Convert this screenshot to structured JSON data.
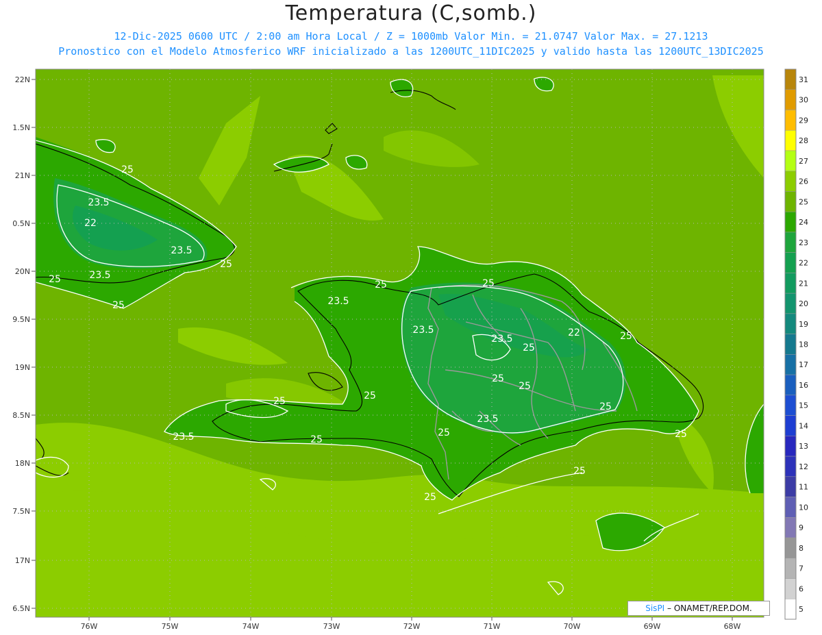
{
  "header": {
    "title": "Temperatura (C,somb.)",
    "subtitle_line1": "12-Dic-2025  0600 UTC / 2:00 am Hora Local / Z = 1000mb   Valor Min. = 21.0747  Valor Max. = 27.1213",
    "subtitle_line2": "Pronostico con el Modelo Atmosferico WRF inicializado a las 1200UTC_11DIC2025 y valido hasta las  1200UTC_13DIC2025"
  },
  "map": {
    "lat_labels": [
      "22N",
      "1.5N",
      "21N",
      "0.5N",
      "20N",
      "9.5N",
      "19N",
      "8.5N",
      "18N",
      "7.5N",
      "17N",
      "6.5N"
    ],
    "lon_labels": [
      "76W",
      "75W",
      "74W",
      "73W",
      "72W",
      "71W",
      "70W",
      "69W",
      "68W"
    ],
    "contour_labels": [
      "25",
      "23.5",
      "22",
      "23.5",
      "25",
      "23.5",
      "25",
      "25",
      "25",
      "25",
      "23.5",
      "23.5",
      "23.5",
      "22",
      "25",
      "25",
      "25",
      "25",
      "25",
      "23.5",
      "25",
      "25",
      "25",
      "23.5",
      "25",
      "25",
      "25",
      "25"
    ]
  },
  "colorbar": {
    "labels": [
      "31",
      "30",
      "29",
      "28",
      "27",
      "26",
      "25",
      "24",
      "23",
      "22",
      "21",
      "20",
      "19",
      "18",
      "17",
      "16",
      "15",
      "14",
      "13",
      "12",
      "11",
      "10",
      "9",
      "8",
      "7",
      "6",
      "5"
    ],
    "colors": [
      "#b8860b",
      "#e09b00",
      "#ffbd00",
      "#ffff00",
      "#b4ff14",
      "#8ccd00",
      "#6eb400",
      "#2ca800",
      "#1ea53c",
      "#14a050",
      "#129b5f",
      "#13946e",
      "#14897d",
      "#15798e",
      "#1770a5",
      "#1a5fbe",
      "#1d4ed2",
      "#1e3ed2",
      "#2828be",
      "#2d32b9",
      "#3c3ca5",
      "#5f5fb4",
      "#8278b4",
      "#969696",
      "#b4b4b4",
      "#d2d2d2",
      "#ffffff"
    ]
  },
  "credit": {
    "logo_text": "SisPI",
    "org": "– ONAMET/REP.DOM."
  }
}
